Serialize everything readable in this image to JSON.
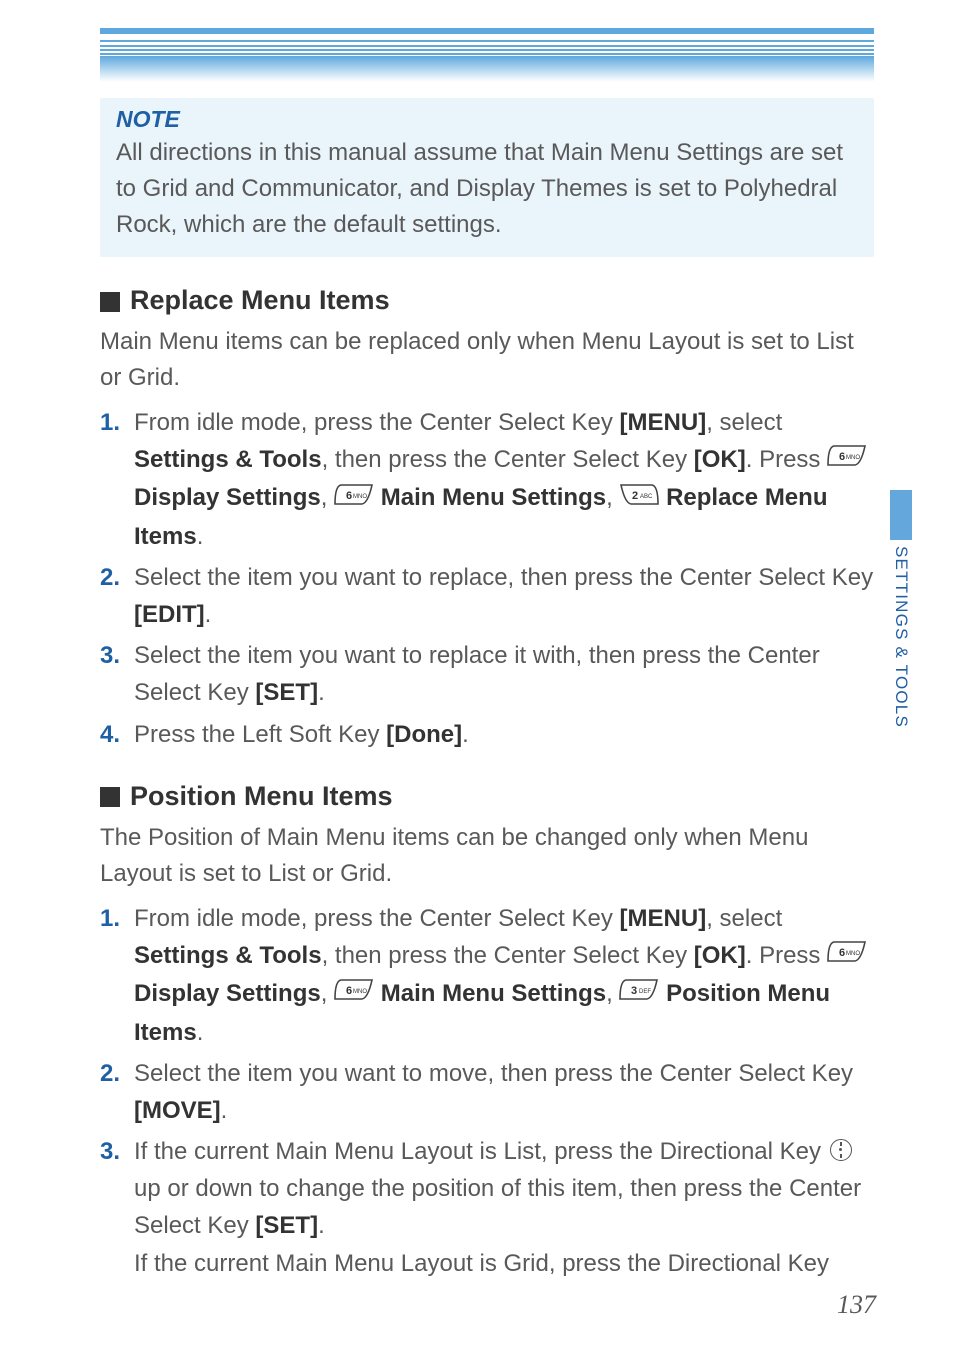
{
  "note": {
    "title": "NOTE",
    "body": "All directions in this manual assume that Main Menu Settings are set to Grid and Communicator, and Display Themes is set to Polyhedral Rock, which are the default settings."
  },
  "side_tab": "SETTINGS & TOOLS",
  "page_number": "137",
  "sections": {
    "replace": {
      "title": "Replace Menu Items",
      "intro": "Main Menu items can be replaced only when Menu Layout is set to List or Grid.",
      "steps": {
        "s1": {
          "t1": "From idle mode, press the Center Select Key ",
          "b1": "[MENU]",
          "t2": ", select ",
          "b2": "Settings & Tools",
          "t3": ", then press the Center Select Key ",
          "b3": "[OK]",
          "t4": ". Press ",
          "b4": "Display Settings",
          "t5": ", ",
          "b5": "Main Menu Settings",
          "t6": ", ",
          "b6": "Replace Menu Items",
          "t7": "."
        },
        "s2": {
          "t1": "Select the item you want to replace, then press the Center Select Key ",
          "b1": "[EDIT]",
          "t2": "."
        },
        "s3": {
          "t1": "Select the item you want to replace it with, then press the Center Select Key ",
          "b1": "[SET]",
          "t2": "."
        },
        "s4": {
          "t1": "Press the Left Soft Key ",
          "b1": "[Done]",
          "t2": "."
        }
      }
    },
    "position": {
      "title": "Position Menu Items",
      "intro": "The Position of Main Menu items can be changed only when Menu Layout is set to List or Grid.",
      "steps": {
        "s1": {
          "t1": "From idle mode, press the Center Select Key ",
          "b1": "[MENU]",
          "t2": ", select ",
          "b2": "Settings & Tools",
          "t3": ", then press the Center Select Key ",
          "b3": "[OK]",
          "t4": ". Press ",
          "b4": "Display Settings",
          "t5": ", ",
          "b5": "Main Menu Settings",
          "t6": ", ",
          "b6": "Position Menu Items",
          "t7": "."
        },
        "s2": {
          "t1": "Select the item you want to move, then press the Center Select Key ",
          "b1": "[MOVE]",
          "t2": "."
        },
        "s3": {
          "t1": "If the current Main Menu Layout is List, press the Directional Key ",
          "t2": " up or down to change the position of this item, then press the Center Select Key ",
          "b1": "[SET]",
          "t3": ".",
          "t4": "If the current Main Menu Layout is Grid, press the Directional Key"
        }
      }
    }
  },
  "keys": {
    "six": {
      "num": "6",
      "letters": "MNO"
    },
    "two": {
      "num": "2",
      "letters": "ABC"
    },
    "three": {
      "num": "3",
      "letters": "DEF"
    }
  }
}
